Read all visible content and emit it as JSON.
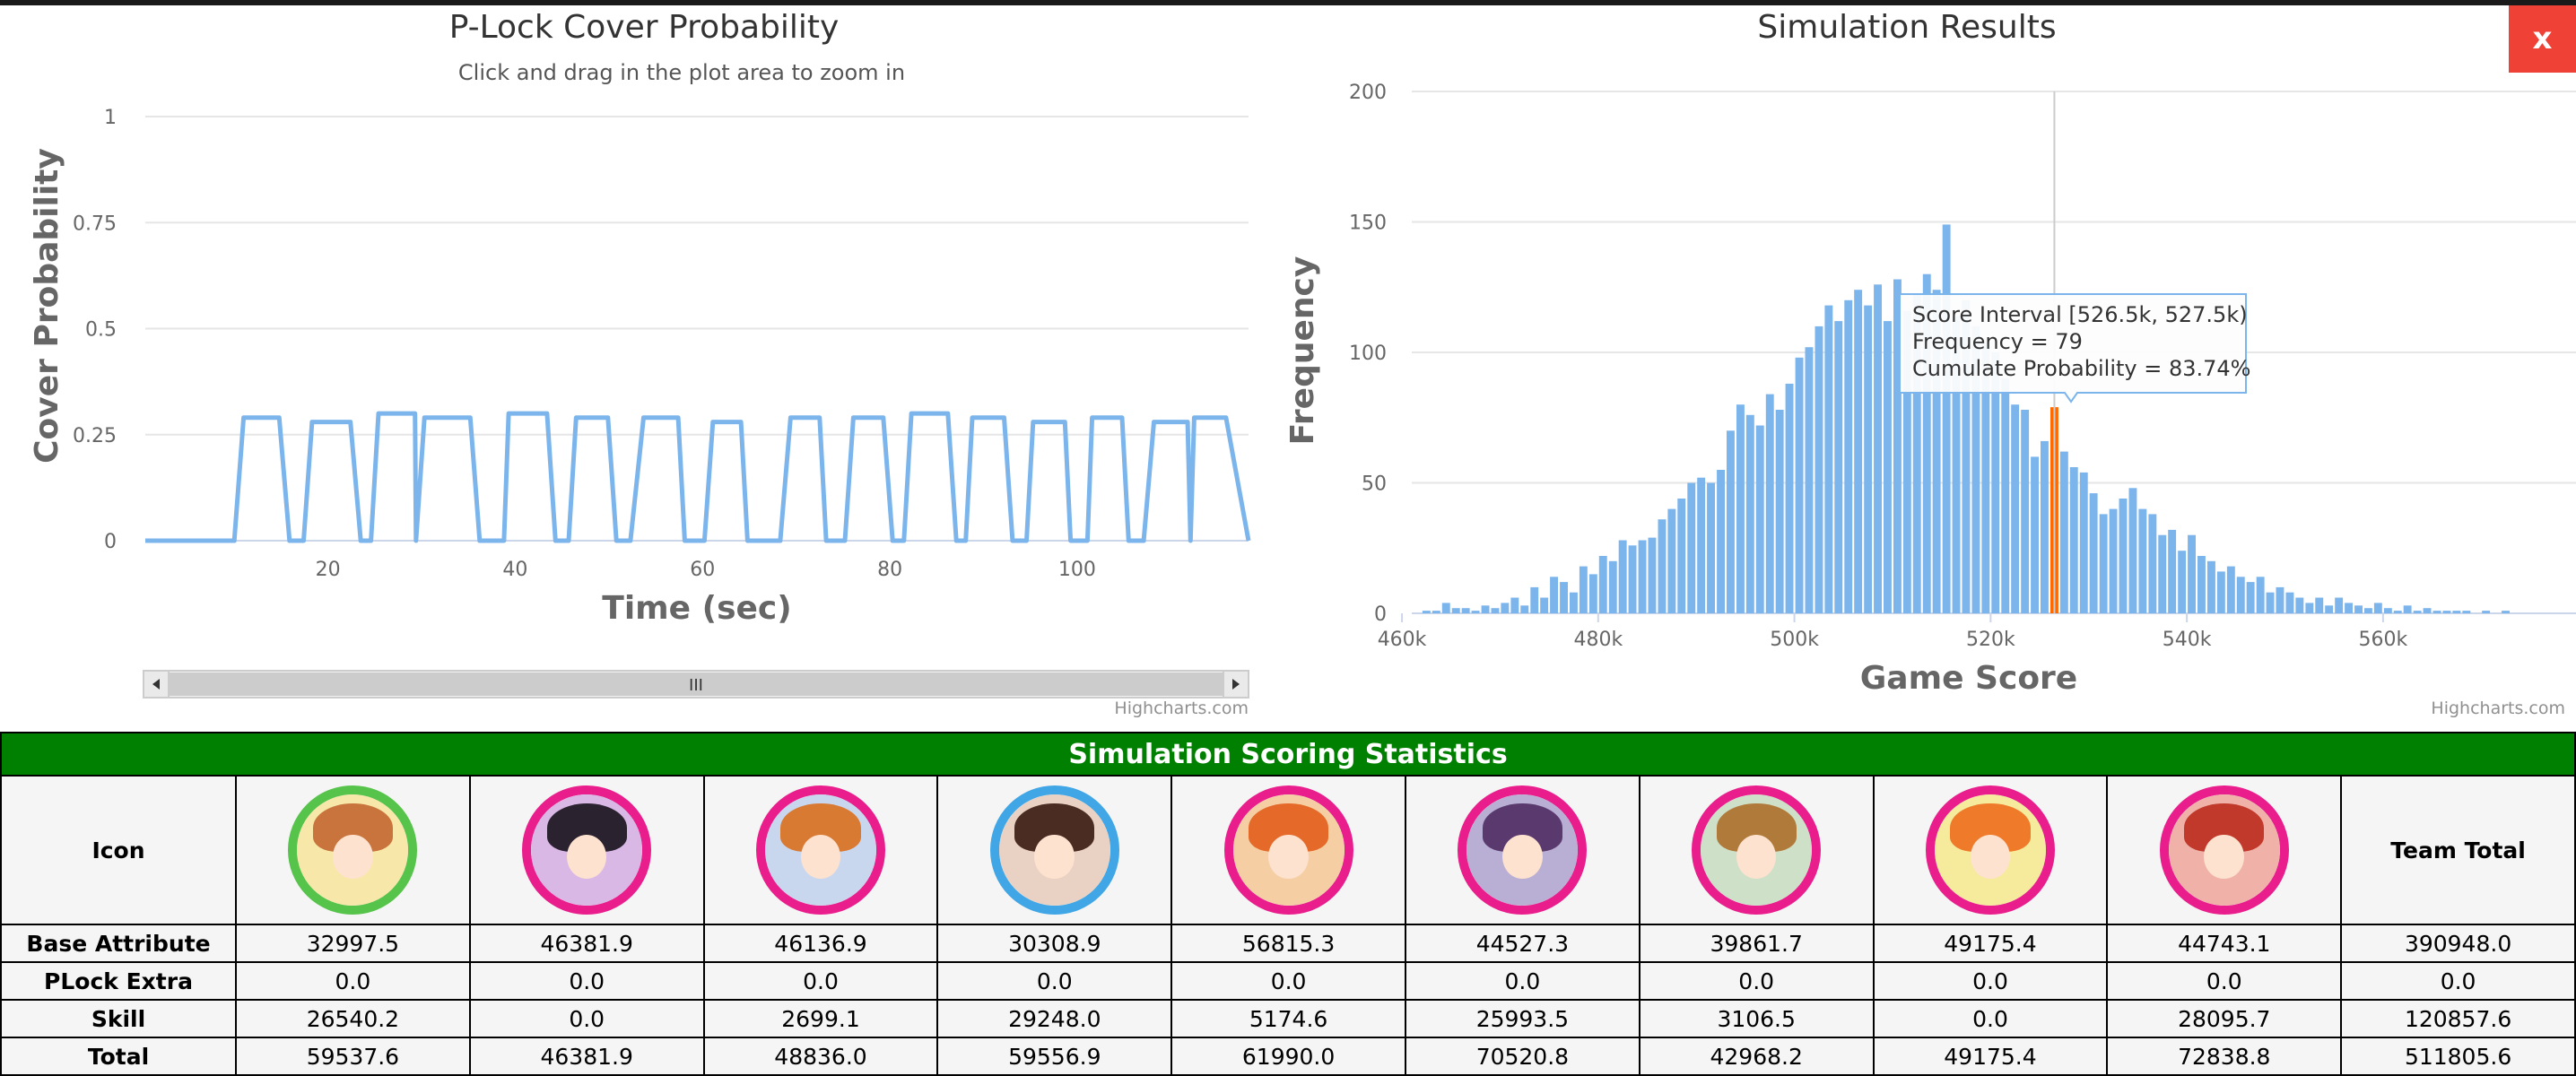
{
  "chart_data": [
    {
      "type": "line",
      "title": "P-Lock Cover Probability",
      "subtitle": "Click and drag in the plot area to zoom in",
      "xlabel": "Time (sec)",
      "ylabel": "Cover Probability",
      "xlim": [
        0.5,
        118.3
      ],
      "ylim": [
        0,
        1
      ],
      "xticks": [
        20,
        40,
        60,
        80,
        100
      ],
      "yticks": [
        0,
        0.25,
        0.5,
        0.75,
        1
      ],
      "ytick_labels": [
        "0",
        "0.25",
        "0.5",
        "0.75",
        "1"
      ],
      "grid": true,
      "credit": "Highcharts.com",
      "scrollbar_grip": "III",
      "series": [
        {
          "color": "#7cb5ec",
          "x": [
            0.5,
            10,
            11,
            14.8,
            15.9,
            17.4,
            18.3,
            22.4,
            23.5,
            24.6,
            25.4,
            29.3,
            29.4,
            30.3,
            35.2,
            36.2,
            38.8,
            39.3,
            43.4,
            44.3,
            45.7,
            46.5,
            49.9,
            50.8,
            52.3,
            53.7,
            57.4,
            58.1,
            60.2,
            61.1,
            64.1,
            64.8,
            68.3,
            69.4,
            72.5,
            73.2,
            75.2,
            76.1,
            79.3,
            80.3,
            81.5,
            82.3,
            86.2,
            87.1,
            88.1,
            88.8,
            92.2,
            93.1,
            94.6,
            95.3,
            98.7,
            99.3,
            101.1,
            101.6,
            104.8,
            105.5,
            107.1,
            108.2,
            111.8,
            112.1,
            112.5,
            115.9,
            118.3
          ],
          "y": [
            0,
            0,
            0.29,
            0.29,
            0,
            0,
            0.28,
            0.28,
            0,
            0,
            0.3,
            0.3,
            0,
            0.29,
            0.29,
            0,
            0,
            0.3,
            0.3,
            0,
            0,
            0.29,
            0.29,
            0,
            0,
            0.29,
            0.29,
            0,
            0,
            0.28,
            0.28,
            0,
            0,
            0.29,
            0.29,
            0,
            0,
            0.29,
            0.29,
            0,
            0,
            0.3,
            0.3,
            0,
            0,
            0.29,
            0.29,
            0,
            0,
            0.28,
            0.28,
            0,
            0,
            0.29,
            0.29,
            0,
            0,
            0.28,
            0.28,
            0,
            0.29,
            0.29,
            0
          ]
        }
      ]
    },
    {
      "type": "bar",
      "title": "Simulation Results",
      "xlabel": "Game Score",
      "ylabel": "Frequency",
      "xlim": [
        461000,
        574000
      ],
      "ylim": [
        0,
        200
      ],
      "xticks": [
        460000,
        480000,
        500000,
        520000,
        540000,
        560000
      ],
      "xtick_labels": [
        "460k",
        "480k",
        "500k",
        "520k",
        "540k",
        "560k"
      ],
      "yticks": [
        0,
        50,
        100,
        150,
        200
      ],
      "grid": true,
      "bin_start": 462000,
      "bin_width": 1000,
      "highlight_bin_start": 526500,
      "highlight_color": "#ff6a00",
      "bar_color": "#7cb5ec",
      "credit": "Highcharts.com",
      "values": [
        1,
        1,
        4,
        2,
        2,
        1,
        3,
        2,
        4,
        6,
        3,
        10,
        6,
        14,
        12,
        8,
        18,
        15,
        22,
        20,
        28,
        26,
        28,
        29,
        36,
        40,
        44,
        50,
        52,
        50,
        55,
        70,
        80,
        76,
        72,
        84,
        78,
        88,
        98,
        102,
        110,
        118,
        112,
        120,
        124,
        118,
        126,
        112,
        128,
        116,
        122,
        130,
        124,
        149,
        114,
        120,
        110,
        104,
        100,
        90,
        80,
        78,
        60,
        66,
        79,
        62,
        56,
        54,
        46,
        38,
        40,
        44,
        48,
        40,
        38,
        30,
        32,
        24,
        30,
        22,
        20,
        16,
        18,
        14,
        12,
        14,
        8,
        10,
        8,
        6,
        4,
        6,
        3,
        6,
        4,
        3,
        2,
        4,
        2,
        1,
        3,
        1,
        2,
        1,
        1,
        1,
        1,
        0,
        1,
        0,
        1,
        0,
        0
      ],
      "crosshair_x": 526500,
      "tooltip": {
        "line1": "Score Interval [526.5k, 527.5k)",
        "line2": "Frequency = 79",
        "line3": "Cumulate Probability = 83.74%"
      }
    }
  ],
  "window": {
    "close_label": "x"
  },
  "stats": {
    "title": "Simulation Scoring Statistics",
    "icon_header": "Icon",
    "team_total_header": "Team Total",
    "icon_names": [
      "card-1-avatar-icon",
      "card-2-avatar-icon",
      "card-3-avatar-icon",
      "card-4-avatar-icon",
      "card-5-avatar-icon",
      "card-6-avatar-icon",
      "card-7-avatar-icon",
      "card-8-avatar-icon",
      "card-9-avatar-icon"
    ],
    "icon_colors": [
      {
        "ring": "#56c34a",
        "bg": "#f7e7a8",
        "hair": "#c8743c"
      },
      {
        "ring": "#e91e8c",
        "bg": "#d9b8e6",
        "hair": "#2b2230"
      },
      {
        "ring": "#e91e8c",
        "bg": "#c9d7ee",
        "hair": "#d97a33"
      },
      {
        "ring": "#40a6e6",
        "bg": "#e9d2c3",
        "hair": "#4a2c22"
      },
      {
        "ring": "#e91e8c",
        "bg": "#f5cfa3",
        "hair": "#e56a2a"
      },
      {
        "ring": "#e91e8c",
        "bg": "#b9aed3",
        "hair": "#5a3a6e"
      },
      {
        "ring": "#e91e8c",
        "bg": "#cfe0c8",
        "hair": "#b07a3a"
      },
      {
        "ring": "#e91e8c",
        "bg": "#f6ea9c",
        "hair": "#ef7a2a"
      },
      {
        "ring": "#e91e8c",
        "bg": "#f0b2a8",
        "hair": "#c0392b"
      }
    ],
    "rows": [
      {
        "label": "Base Attribute",
        "values": [
          "32997.5",
          "46381.9",
          "46136.9",
          "30308.9",
          "56815.3",
          "44527.3",
          "39861.7",
          "49175.4",
          "44743.1"
        ],
        "total": "390948.0"
      },
      {
        "label": "PLock Extra",
        "values": [
          "0.0",
          "0.0",
          "0.0",
          "0.0",
          "0.0",
          "0.0",
          "0.0",
          "0.0",
          "0.0"
        ],
        "total": "0.0"
      },
      {
        "label": "Skill",
        "values": [
          "26540.2",
          "0.0",
          "2699.1",
          "29248.0",
          "5174.6",
          "25993.5",
          "3106.5",
          "0.0",
          "28095.7"
        ],
        "total": "120857.6"
      },
      {
        "label": "Total",
        "values": [
          "59537.6",
          "46381.9",
          "48836.0",
          "59556.9",
          "61990.0",
          "70520.8",
          "42968.2",
          "49175.4",
          "72838.8"
        ],
        "total": "511805.6"
      }
    ]
  }
}
